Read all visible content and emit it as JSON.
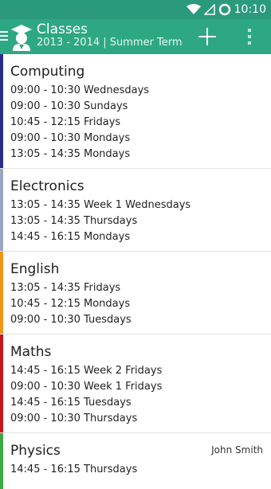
{
  "status": {
    "time": "10:10"
  },
  "app_bar": {
    "title": "Classes",
    "subtitle": "2013 - 2014 | Summer Term"
  },
  "colors": {
    "status_bar": "#2b9a7c",
    "app_bar": "#2ea884"
  },
  "classes": [
    {
      "name": "Computing",
      "color": "#2a2c8c",
      "slots": [
        "09:00 - 10:30 Wednesdays",
        "09:00 - 10:30 Sundays",
        "10:45 - 12:15 Fridays",
        "09:00 - 10:30 Mondays",
        "13:05 - 14:35 Mondays"
      ]
    },
    {
      "name": "Electronics",
      "color": "#9aa6bc",
      "slots": [
        "13:05 - 14:35 Week 1 Wednesdays",
        "13:05 - 14:35 Thursdays",
        "14:45 - 16:15 Mondays"
      ]
    },
    {
      "name": "English",
      "color": "#ef9518",
      "slots": [
        "13:05 - 14:35 Fridays",
        "10:45 - 12:15 Mondays",
        "09:00 - 10:30 Tuesdays"
      ]
    },
    {
      "name": "Maths",
      "color": "#c4161c",
      "slots": [
        "14:45 - 16:15 Week 2 Fridays",
        "09:00 - 10:30 Week 1 Fridays",
        "14:45 - 16:15 Tuesdays",
        "09:00 - 10:30 Thursdays"
      ]
    },
    {
      "name": "Physics",
      "color": "#3ba845",
      "teacher": "John Smith",
      "slots": [
        "14:45 - 16:15 Thursdays"
      ]
    }
  ]
}
